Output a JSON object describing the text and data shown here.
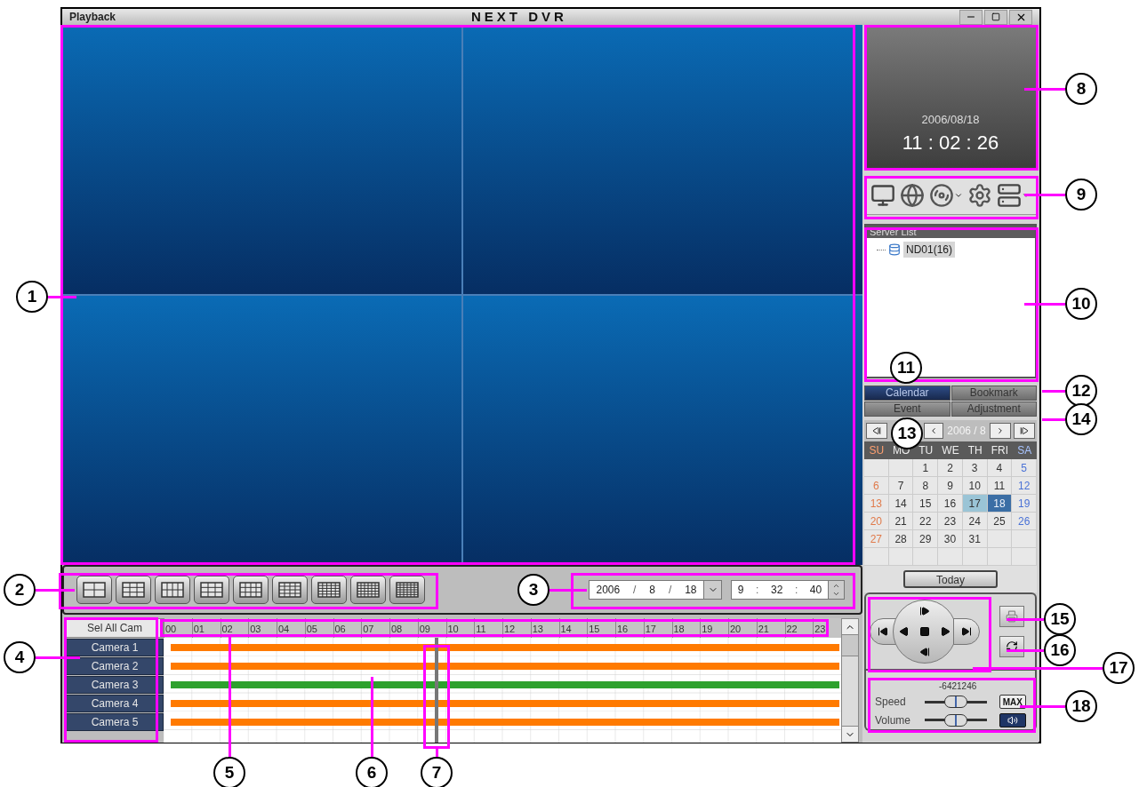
{
  "window": {
    "title": "Playback",
    "app_name": "NEXT DVR"
  },
  "date_field": {
    "parts": [
      "2006",
      "/",
      "8",
      "/",
      "18"
    ]
  },
  "time_field": {
    "parts": [
      "9",
      ":",
      "32",
      ":",
      "40"
    ]
  },
  "timeline": {
    "select_all": "Sel All Cam",
    "hours": [
      "00",
      "01",
      "02",
      "03",
      "04",
      "05",
      "06",
      "07",
      "08",
      "09",
      "10",
      "11",
      "12",
      "13",
      "14",
      "15",
      "16",
      "17",
      "18",
      "19",
      "20",
      "21",
      "22",
      "23"
    ],
    "cameras": [
      {
        "name": "Camera 1",
        "color": "#ff7a00"
      },
      {
        "name": "Camera 2",
        "color": "#ff7a00"
      },
      {
        "name": "Camera 3",
        "color": "#2ea12e"
      },
      {
        "name": "Camera 4",
        "color": "#ff7a00"
      },
      {
        "name": "Camera 5",
        "color": "#ff7a00"
      }
    ],
    "playhead": {
      "level": 0.4
    }
  },
  "clock": {
    "date": "2006/08/18",
    "time": "11 : 02 : 26"
  },
  "server_list": {
    "title": "Server List",
    "servers": [
      {
        "name": "ND01(16)",
        "selected": true
      }
    ]
  },
  "tabs": [
    {
      "label": "Calendar",
      "selected": true
    },
    {
      "label": "Bookmark",
      "selected": false
    },
    {
      "label": "Event",
      "selected": false
    },
    {
      "label": "Adjustment",
      "selected": false
    }
  ],
  "calendar": {
    "month": "2006 / 8",
    "weekdays": [
      {
        "label": "SU",
        "kind": "sunday"
      },
      {
        "label": "MO",
        "kind": "weekday"
      },
      {
        "label": "TU",
        "kind": "weekday"
      },
      {
        "label": "WE",
        "kind": "weekday"
      },
      {
        "label": "TH",
        "kind": "weekday"
      },
      {
        "label": "FRI",
        "kind": "weekday"
      },
      {
        "label": "SA",
        "kind": "saturday"
      }
    ],
    "weeks": [
      [
        {
          "kind": "blank"
        },
        {
          "kind": "blank"
        },
        {
          "kind": "weekday",
          "day": "1",
          "selected": false,
          "highlighted": false
        },
        {
          "kind": "weekday",
          "day": "2",
          "selected": false,
          "highlighted": false
        },
        {
          "kind": "weekday",
          "day": "3",
          "selected": false,
          "highlighted": false
        },
        {
          "kind": "weekday",
          "day": "4",
          "selected": false,
          "highlighted": false
        },
        {
          "kind": "saturday",
          "day": "5",
          "selected": false,
          "highlighted": false
        }
      ],
      [
        {
          "kind": "sunday",
          "day": "6",
          "selected": false,
          "highlighted": false
        },
        {
          "kind": "weekday",
          "day": "7",
          "selected": false,
          "highlighted": false
        },
        {
          "kind": "weekday",
          "day": "8",
          "selected": false,
          "highlighted": false
        },
        {
          "kind": "weekday",
          "day": "9",
          "selected": false,
          "highlighted": false
        },
        {
          "kind": "weekday",
          "day": "10",
          "selected": false,
          "highlighted": false
        },
        {
          "kind": "weekday",
          "day": "11",
          "selected": false,
          "highlighted": false
        },
        {
          "kind": "saturday",
          "day": "12",
          "selected": false,
          "highlighted": false
        }
      ],
      [
        {
          "kind": "sunday",
          "day": "13",
          "selected": false,
          "highlighted": false
        },
        {
          "kind": "weekday",
          "day": "14",
          "selected": false,
          "highlighted": false
        },
        {
          "kind": "weekday",
          "day": "15",
          "selected": false,
          "highlighted": false
        },
        {
          "kind": "weekday",
          "day": "16",
          "selected": false,
          "highlighted": false
        },
        {
          "kind": "weekday",
          "day": "17",
          "selected": false,
          "highlighted": true
        },
        {
          "kind": "weekday",
          "day": "18",
          "selected": true,
          "highlighted": false
        },
        {
          "kind": "saturday",
          "day": "19",
          "selected": false,
          "highlighted": false
        }
      ],
      [
        {
          "kind": "sunday",
          "day": "20",
          "selected": false,
          "highlighted": false
        },
        {
          "kind": "weekday",
          "day": "21",
          "selected": false,
          "highlighted": false
        },
        {
          "kind": "weekday",
          "day": "22",
          "selected": false,
          "highlighted": false
        },
        {
          "kind": "weekday",
          "day": "23",
          "selected": false,
          "highlighted": false
        },
        {
          "kind": "weekday",
          "day": "24",
          "selected": false,
          "highlighted": false
        },
        {
          "kind": "weekday",
          "day": "25",
          "selected": false,
          "highlighted": false
        },
        {
          "kind": "saturday",
          "day": "26",
          "selected": false,
          "highlighted": false
        }
      ],
      [
        {
          "kind": "sunday",
          "day": "27",
          "selected": false,
          "highlighted": false
        },
        {
          "kind": "weekday",
          "day": "28",
          "selected": false,
          "highlighted": false
        },
        {
          "kind": "weekday",
          "day": "29",
          "selected": false,
          "highlighted": false
        },
        {
          "kind": "weekday",
          "day": "30",
          "selected": false,
          "highlighted": false
        },
        {
          "kind": "weekday",
          "day": "31",
          "selected": false,
          "highlighted": false
        },
        {
          "kind": "blank"
        },
        {
          "kind": "blank"
        }
      ],
      [
        {
          "kind": "blank"
        },
        {
          "kind": "blank"
        },
        {
          "kind": "blank"
        },
        {
          "kind": "blank"
        },
        {
          "kind": "blank"
        },
        {
          "kind": "blank"
        },
        {
          "kind": "blank"
        }
      ]
    ],
    "today_button": "Today"
  },
  "speed": {
    "label": "Speed",
    "scale": "-6421246",
    "level": 0.5,
    "max_button": "MAX"
  },
  "volume": {
    "label": "Volume",
    "level": 0.5
  },
  "callouts": [
    {
      "number": "1"
    },
    {
      "number": "2"
    },
    {
      "number": "3"
    },
    {
      "number": "4"
    },
    {
      "number": "5"
    },
    {
      "number": "6"
    },
    {
      "number": "7"
    },
    {
      "number": "8"
    },
    {
      "number": "9"
    },
    {
      "number": "10"
    },
    {
      "number": "11"
    },
    {
      "number": "12"
    },
    {
      "number": "13"
    },
    {
      "number": "14"
    },
    {
      "number": "15"
    },
    {
      "number": "16"
    },
    {
      "number": "17"
    },
    {
      "number": "18"
    }
  ]
}
